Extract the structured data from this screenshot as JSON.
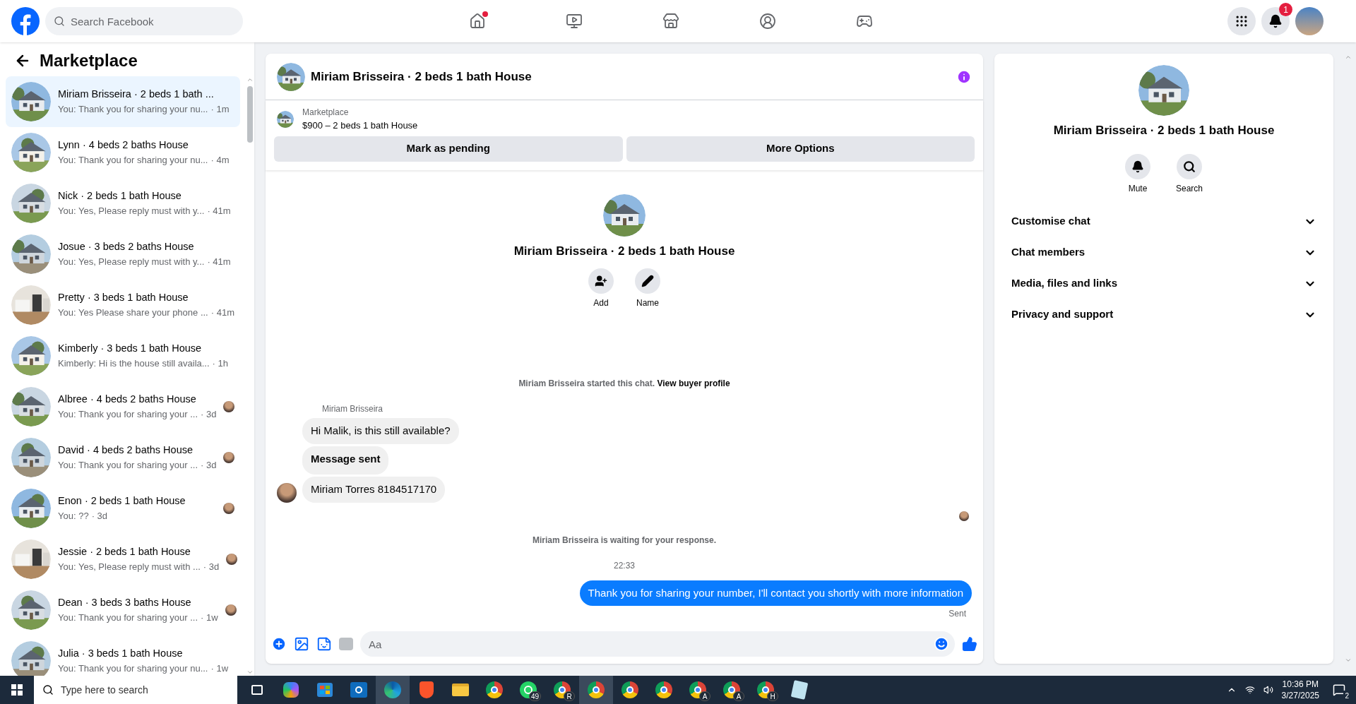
{
  "top_bar": {
    "search": {
      "placeholder": "Search Facebook"
    },
    "nav_tabs": [
      {
        "kind": "home",
        "dot": true
      },
      {
        "kind": "video",
        "dot": false
      },
      {
        "kind": "marketplace",
        "dot": false
      },
      {
        "kind": "groups",
        "dot": false
      },
      {
        "kind": "gaming",
        "dot": false
      }
    ],
    "notifications_badge": "1"
  },
  "sidebar": {
    "title": "Marketplace",
    "conversations": [
      {
        "title": "Miriam Brisseira · 2 beds 1 bath ...",
        "preview": "You: Thank you for sharing your nu...",
        "time": "· 1m",
        "selected": true,
        "seen": false
      },
      {
        "title": "Lynn · 4 beds 2 baths House",
        "preview": "You: Thank you for sharing your nu...",
        "time": "· 4m",
        "selected": false,
        "seen": false
      },
      {
        "title": "Nick · 2 beds 1 bath House",
        "preview": "You: Yes, Please reply must with y...",
        "time": "· 41m",
        "selected": false,
        "seen": false
      },
      {
        "title": "Josue · 3 beds 2 baths House",
        "preview": "You: Yes, Please reply must with y...",
        "time": "· 41m",
        "selected": false,
        "seen": false
      },
      {
        "title": "Pretty · 3 beds 1 bath House",
        "preview": "You: Yes Please share your phone ...",
        "time": "· 41m",
        "selected": false,
        "seen": false
      },
      {
        "title": "Kimberly · 3 beds 1 bath House",
        "preview": "Kimberly: Hi is the house still availa...",
        "time": "· 1h",
        "selected": false,
        "seen": false
      },
      {
        "title": "Albree · 4 beds 2 baths House",
        "preview": "You: Thank you for sharing your ...",
        "time": "· 3d",
        "selected": false,
        "seen": true
      },
      {
        "title": "David · 4 beds 2 baths House",
        "preview": "You: Thank you for sharing your ...",
        "time": "· 3d",
        "selected": false,
        "seen": true
      },
      {
        "title": "Enon · 2 beds 1 bath House",
        "preview": "You: ??",
        "time": "· 3d",
        "selected": false,
        "seen": true
      },
      {
        "title": "Jessie · 2 beds 1 bath House",
        "preview": "You: Yes, Please reply must with ...",
        "time": "· 3d",
        "selected": false,
        "seen": true
      },
      {
        "title": "Dean · 3 beds 3 baths House",
        "preview": "You: Thank you for sharing your ...",
        "time": "· 1w",
        "selected": false,
        "seen": true
      },
      {
        "title": "Julia · 3 beds 1 bath House",
        "preview": "You: Thank you for sharing your nu...",
        "time": "· 1w",
        "selected": false,
        "seen": false
      }
    ]
  },
  "chat": {
    "title": "Miriam Brisseira · 2 beds 1 bath House",
    "listing": {
      "source": "Marketplace",
      "title": "$900 – 2 beds 1 bath House"
    },
    "buttons": [
      "Mark as pending",
      "More Options"
    ],
    "intro": {
      "title": "Miriam Brisseira · 2 beds 1 bath House",
      "actions": [
        {
          "kind": "add",
          "label": "Add"
        },
        {
          "kind": "name",
          "label": "Name"
        }
      ]
    },
    "started_text": "Miriam Brisseira started this chat.",
    "profile_link": "View buyer profile",
    "sender_name": "Miriam Brisseira",
    "messages": [
      {
        "kind": "incoming",
        "text": "Hi Malik, is this still available?",
        "bold": false
      },
      {
        "kind": "incoming",
        "text": "Message sent",
        "bold": true
      },
      {
        "kind": "incoming",
        "text": "Miriam Torres 8184517170",
        "bold": false
      }
    ],
    "waiting_text": "Miriam Brisseira is waiting for your response.",
    "timestamp": "22:33",
    "outgoing": [
      {
        "kind": "outgoing",
        "text": "Thank you for sharing your number, I'll contact you shortly with more information",
        "bold": false
      }
    ],
    "status": "Sent",
    "composer": {
      "placeholder": "Aa"
    }
  },
  "info_panel": {
    "title": "Miriam Brisseira · 2 beds 1 bath House",
    "actions": [
      {
        "kind": "mute",
        "label": "Mute"
      },
      {
        "kind": "search",
        "label": "Search"
      }
    ],
    "sections": [
      {
        "label": "Customise chat",
        "expanded": false
      },
      {
        "label": "Chat members",
        "expanded": false
      },
      {
        "label": "Media, files and links",
        "expanded": false
      },
      {
        "label": "Privacy and support",
        "expanded": false
      }
    ]
  },
  "taskbar": {
    "search": {
      "placeholder": "Type here to search"
    },
    "apps": [
      {
        "kind": "taskview",
        "selected": false
      },
      {
        "kind": "copilot",
        "selected": false
      },
      {
        "kind": "store",
        "selected": false
      },
      {
        "kind": "outlook",
        "selected": false
      },
      {
        "kind": "edge",
        "selected": true
      },
      {
        "kind": "brave",
        "selected": false
      },
      {
        "kind": "files",
        "selected": false
      },
      {
        "kind": "chrome",
        "selected": false
      },
      {
        "kind": "whatsapp",
        "badge": "49",
        "selected": false
      },
      {
        "kind": "chrome",
        "badge": "R",
        "selected": false
      },
      {
        "kind": "chrome",
        "selected": true
      },
      {
        "kind": "chrome",
        "selected": false
      },
      {
        "kind": "chrome",
        "selected": false
      },
      {
        "kind": "chrome",
        "badge": "A",
        "selected": false
      },
      {
        "kind": "chrome",
        "badge": "A",
        "selected": false
      },
      {
        "kind": "chrome",
        "badge": "H",
        "selected": false
      },
      {
        "kind": "notepad",
        "selected": false
      }
    ],
    "time": "10:36 PM",
    "date": "3/27/2025",
    "notifications": "2"
  }
}
